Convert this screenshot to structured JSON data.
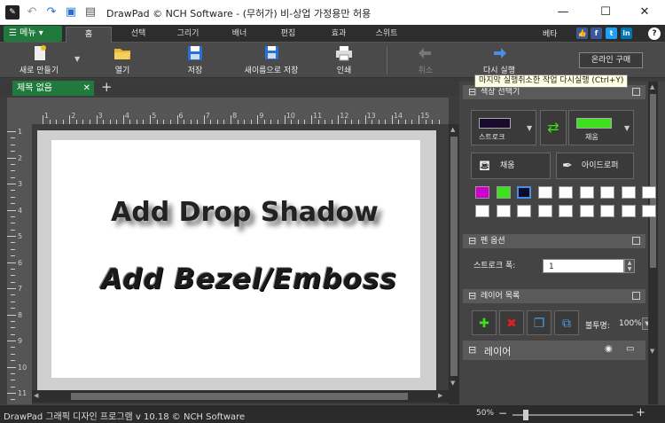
{
  "app": {
    "title": "DrawPad © NCH Software - (무허가) 비-상업 가정용만 허용"
  },
  "colors": {
    "accent": "#1f7a3c",
    "stroke": "#1a0a2e",
    "fill": "#3de01e"
  },
  "menu": {
    "menu_button": "메뉴 ▾",
    "tabs": [
      "홈",
      "선택",
      "그리기",
      "배너",
      "편집",
      "효과",
      "스위트"
    ],
    "beta": "베타"
  },
  "toolbar": {
    "new": "새로 만들기",
    "open": "열기",
    "save": "저장",
    "save_as": "새이름으로 저장",
    "print": "인쇄",
    "undo": "취소",
    "redo": "다시 실행",
    "buy": "온라인 구매"
  },
  "tooltip": "마지막 실행취소한 작업 다시실행 (Ctrl+Y)",
  "document": {
    "tab_name": "제목 없음",
    "text1": "Add Drop Shadow",
    "text2": "Add Bezel/Emboss"
  },
  "ruler": {
    "h": [
      "1",
      "2",
      "3",
      "4",
      "5",
      "6",
      "7",
      "8",
      "9",
      "10",
      "11",
      "12",
      "13",
      "14",
      "15"
    ],
    "v": [
      "1",
      "2",
      "3",
      "4",
      "5",
      "6",
      "7",
      "8",
      "9",
      "10",
      "11"
    ]
  },
  "panels": {
    "color": {
      "title": "색상 선택기",
      "stroke": "스트로크",
      "fill_label": "채움",
      "fill_btn": "채움",
      "eyedropper": "아이드로퍼",
      "swatches": [
        "#d000d0",
        "#3de01e",
        "#0a0a2a",
        "#ffffff",
        "#ffffff",
        "#ffffff",
        "#ffffff",
        "#ffffff",
        "#ffffff",
        "#ffffff",
        "#ffffff",
        "#ffffff",
        "#ffffff",
        "#ffffff",
        "#ffffff",
        "#ffffff",
        "#ffffff",
        "#ffffff"
      ]
    },
    "pen": {
      "title": "펜 옵션",
      "stroke_width_label": "스트로크 폭:",
      "stroke_width_value": "1"
    },
    "layers": {
      "title": "레이어 목록",
      "opacity_label": "불투명:",
      "opacity_value": "100%",
      "layer_name": "레이어"
    }
  },
  "status": {
    "text": "DrawPad 그래픽 디자인 프로그램 v 10.18 © NCH Software",
    "zoom": "50%"
  }
}
